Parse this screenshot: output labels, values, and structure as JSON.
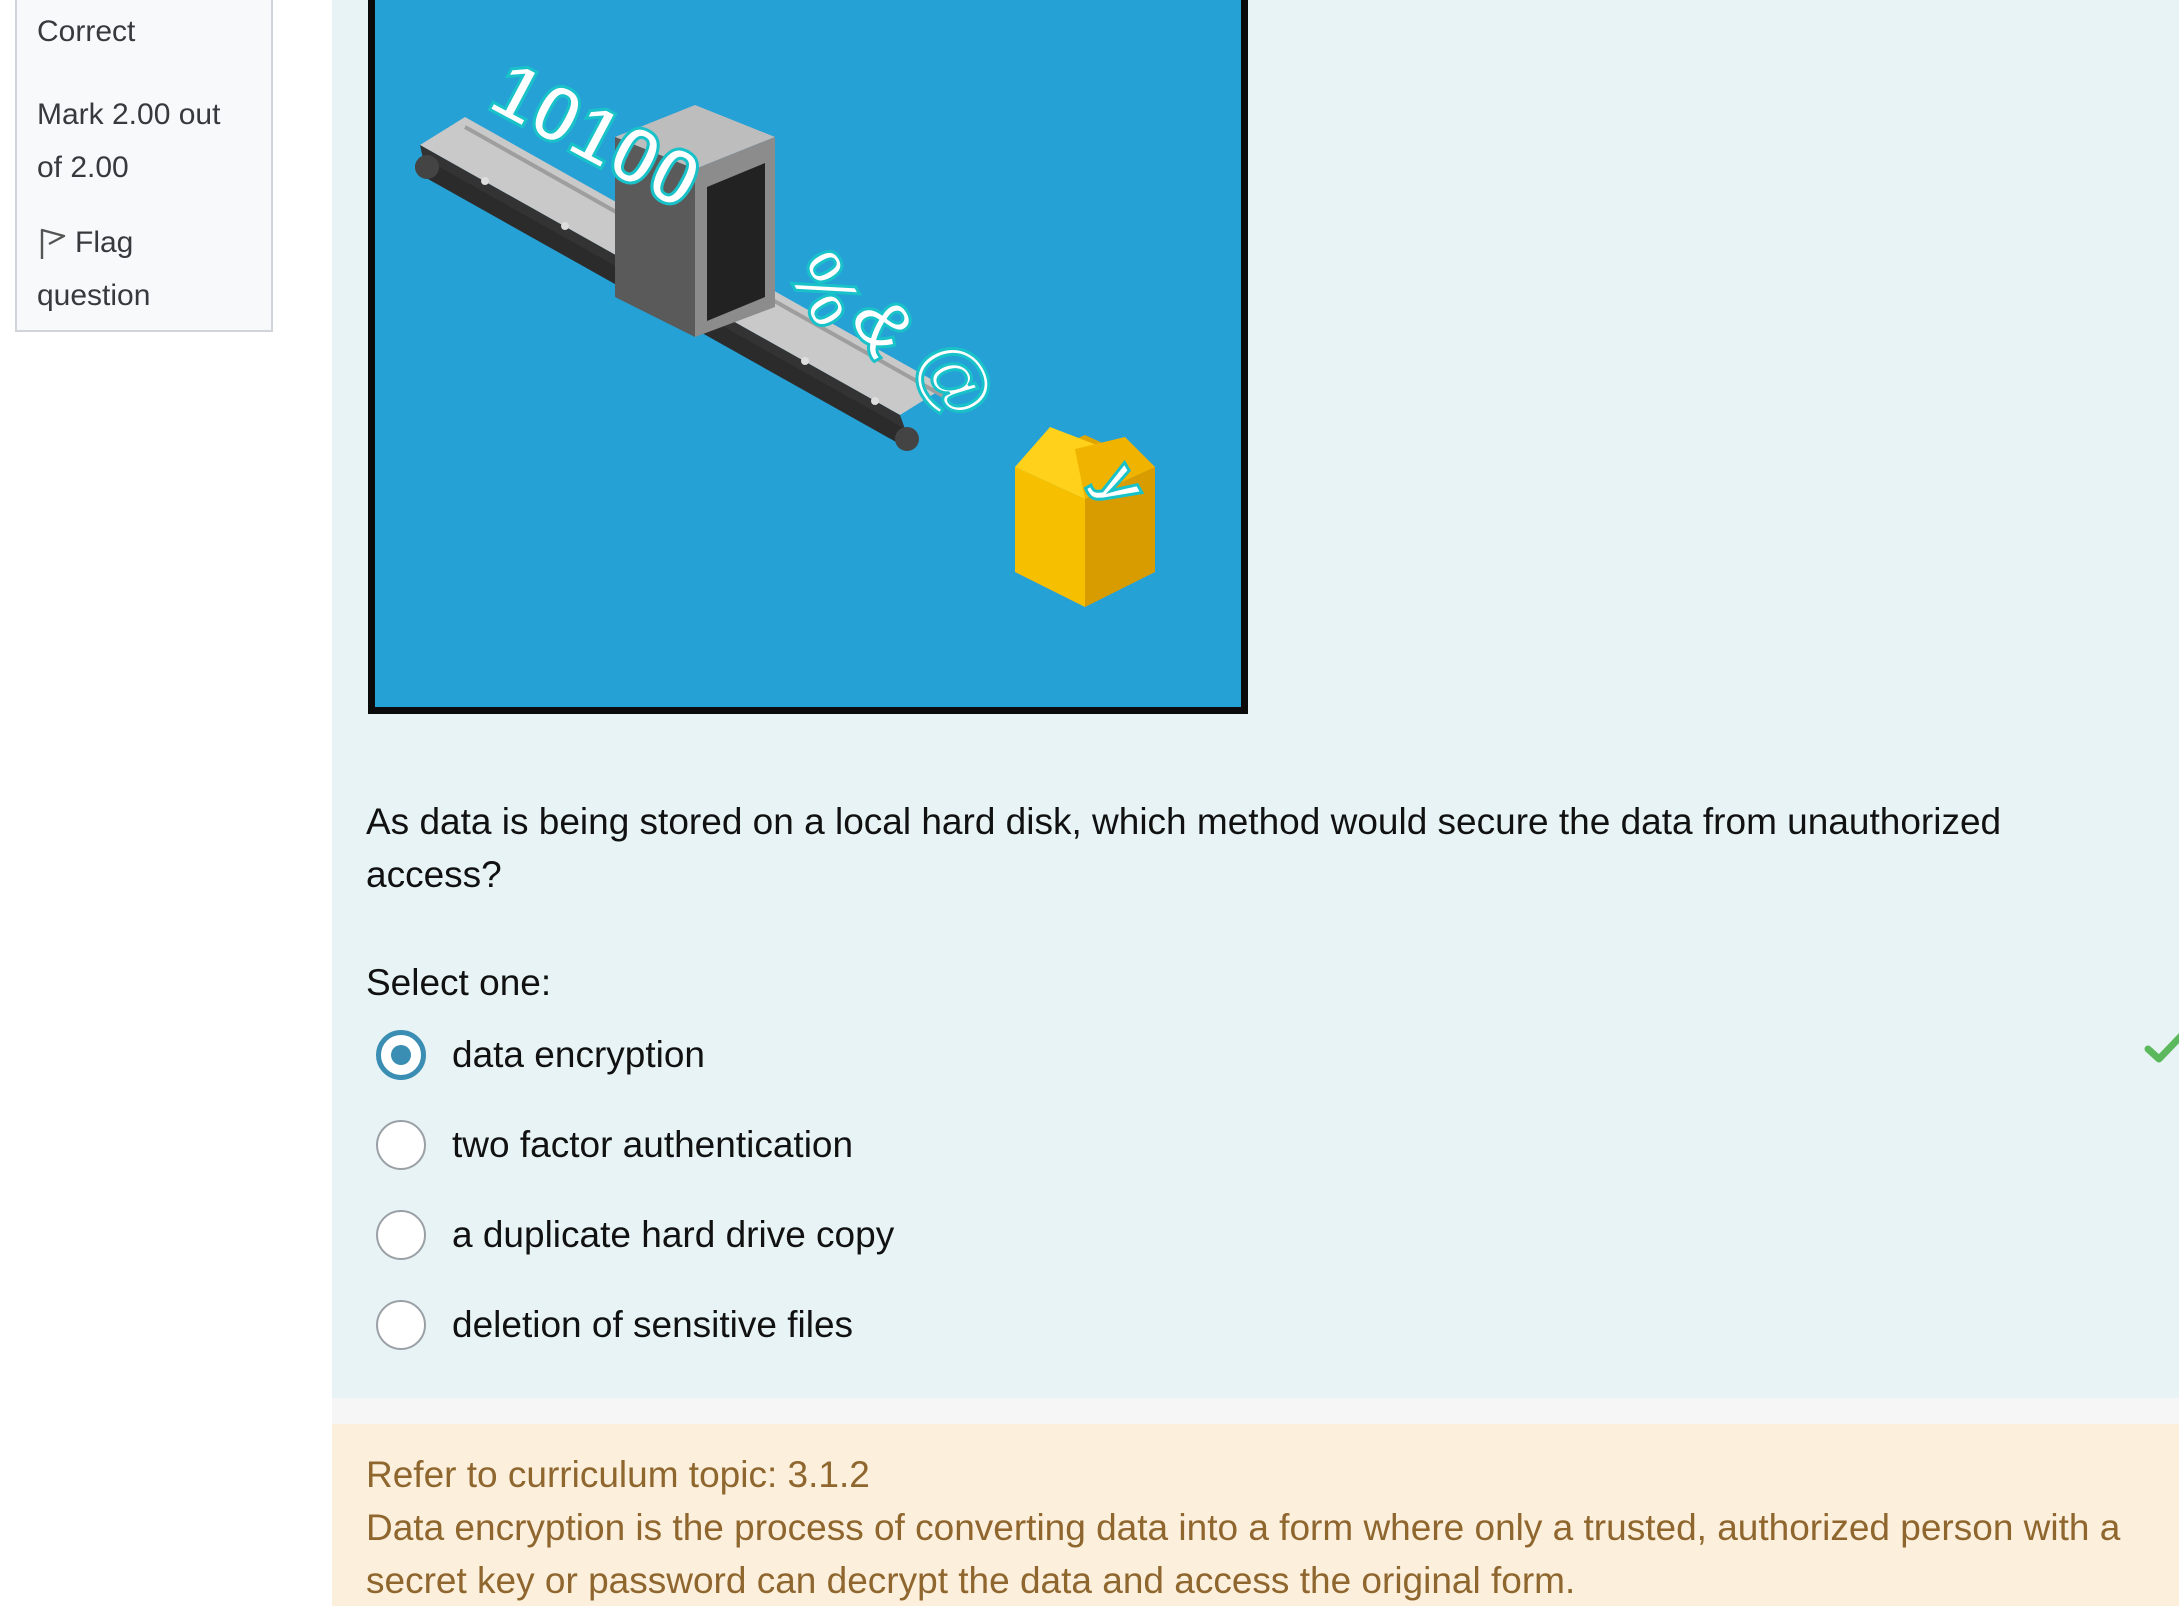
{
  "info": {
    "state": "Correct",
    "grade": "Mark 2.00 out of 2.00",
    "flag_label": "Flag question"
  },
  "question": {
    "image": {
      "title_digits": "10100",
      "symbol_percent": "%",
      "symbol_amp": "&",
      "symbol_at": "@",
      "symbol_y": "y",
      "background_color": "#26a1d6",
      "box_color": "#f6c000"
    },
    "text": "As data is being stored on a local hard disk, which method would secure the data from unauthorized access?",
    "prompt": "Select one:",
    "options": [
      {
        "label": "data encryption",
        "selected": true,
        "correct": true
      },
      {
        "label": "two factor authentication",
        "selected": false
      },
      {
        "label": "a duplicate hard drive copy",
        "selected": false
      },
      {
        "label": "deletion of sensitive files",
        "selected": false
      }
    ],
    "correct_icon": "checkmark-icon",
    "correct_color": "#5cb85c",
    "accent_color": "#3a8eb3"
  },
  "feedback": {
    "topic": "Refer to curriculum topic: 3.1.2",
    "explanation": "Data encryption is the process of converting data into a form where only a trusted, authorized person with a secret key or password can decrypt the data and access the original form."
  }
}
